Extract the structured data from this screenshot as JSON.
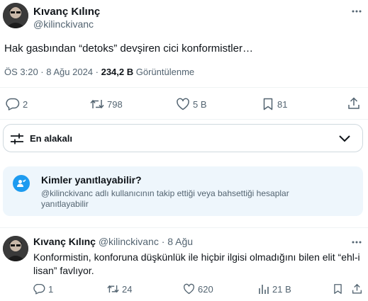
{
  "main_tweet": {
    "author_name": "Kıvanç Kılınç",
    "author_handle": "@kilinckivanc",
    "text": "Hak gasbından “detoks” devşiren cici konformistler…",
    "time": "ÖS 3:20 · 8 Ağu 2024 · ",
    "views_count": "234,2 B",
    "views_label": " Görüntülenme",
    "replies": "2",
    "reposts": "798",
    "likes": "5 B",
    "bookmarks": "81"
  },
  "sort": {
    "label": "En alakalı"
  },
  "reply_restriction": {
    "title": "Kimler yanıtlayabilir?",
    "description": "@kilinckivanc adlı kullanıcının takip ettiği veya bahsettiği hesaplar yanıtlayabilir"
  },
  "reply_tweet": {
    "author_name": "Kıvanç Kılınç",
    "author_handle": "@kilinckivanc",
    "date": " · 8 Ağu",
    "text": "Konformistin, konforuna düşkünlük ile hiçbir ilgisi olmadığını bilen elit “ehl-i lisan” favlıyor.",
    "replies": "1",
    "reposts": "24",
    "likes": "620",
    "views": "21 B"
  },
  "colors": {
    "text_primary": "#0f1419",
    "text_secondary": "#536471",
    "accent": "#1d9bf0",
    "info_bg": "#eef6fc",
    "divider": "#eff3f4"
  },
  "icons": [
    "more-icon",
    "reply-icon",
    "repost-icon",
    "like-icon",
    "bookmark-icon",
    "share-icon",
    "filter-icon",
    "chevron-down-icon",
    "reply-permission-icon",
    "views-icon"
  ]
}
